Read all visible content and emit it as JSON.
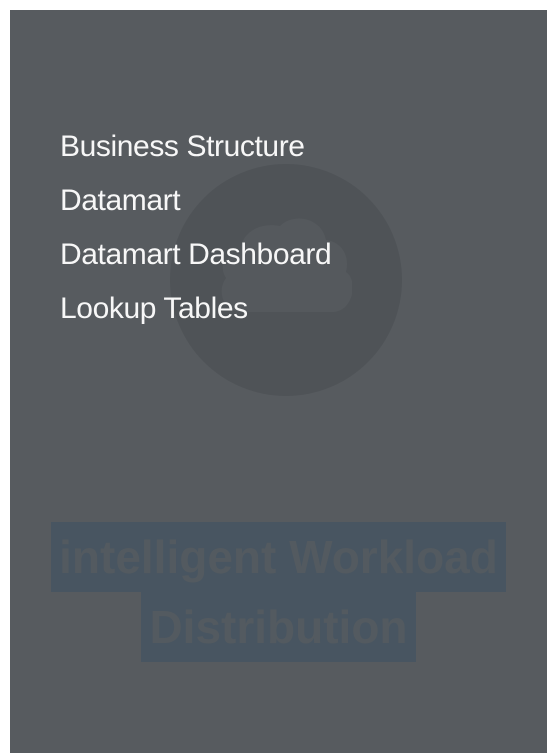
{
  "menu": {
    "items": [
      {
        "label": "Business Structure"
      },
      {
        "label": "Datamart"
      },
      {
        "label": "Datamart Dashboard"
      },
      {
        "label": "Lookup Tables"
      }
    ]
  },
  "watermark": {
    "icon": "cloud-logo-icon"
  },
  "tagline": {
    "line1": "intelligent Workload",
    "line2": "Distribution"
  },
  "colors": {
    "panel_bg": "#575b5f",
    "menu_text": "#f7f7f7",
    "tagline_highlight": "#485561"
  }
}
